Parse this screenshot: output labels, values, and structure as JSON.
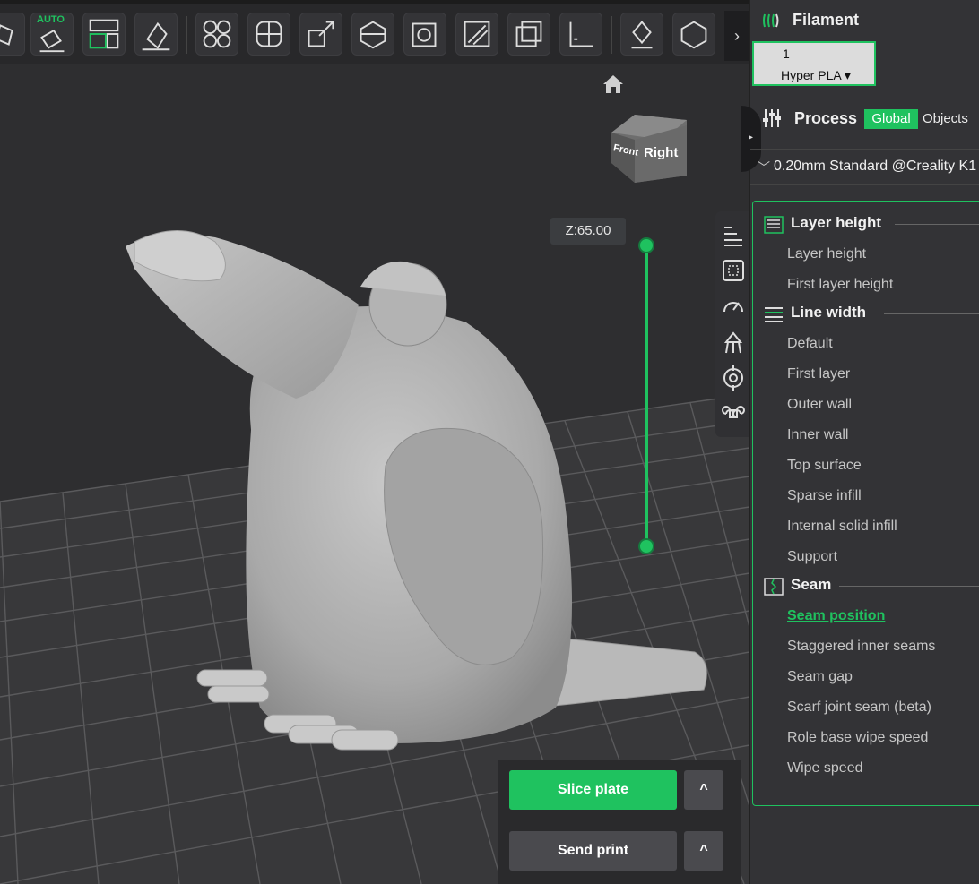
{
  "toolbar": {
    "auto_label": "AUTO",
    "expand_icon": "›"
  },
  "viewport": {
    "cube_front": "Front",
    "cube_right": "Right",
    "z_value": "Z:65.00"
  },
  "actions": {
    "slice_label": "Slice plate",
    "send_label": "Send print",
    "arrow": "^"
  },
  "side_panel": {
    "filament_title": "Filament",
    "filament_slot_number": "1",
    "filament_name": "Hyper PLA ▾",
    "process_title": "Process",
    "tab_global": "Global",
    "tab_objects": "Objects",
    "preset": "0.20mm Standard @Creality K1",
    "preset_chevron": "﹀",
    "sections": [
      {
        "title": "Layer height",
        "options": [
          "Layer height",
          "First layer height"
        ]
      },
      {
        "title": "Line width",
        "options": [
          "Default",
          "First layer",
          "Outer wall",
          "Inner wall",
          "Top surface",
          "Sparse infill",
          "Internal solid infill",
          "Support"
        ]
      },
      {
        "title": "Seam",
        "options": [
          "Seam position",
          "Staggered inner seams",
          "Seam gap",
          "Scarf joint seam (beta)",
          "Role base wipe speed",
          "Wipe speed"
        ]
      }
    ],
    "active_option": "Seam position"
  },
  "colors": {
    "accent": "#1fc25f",
    "panel_bg": "#333336",
    "viewport_bg": "#2e2e30"
  }
}
